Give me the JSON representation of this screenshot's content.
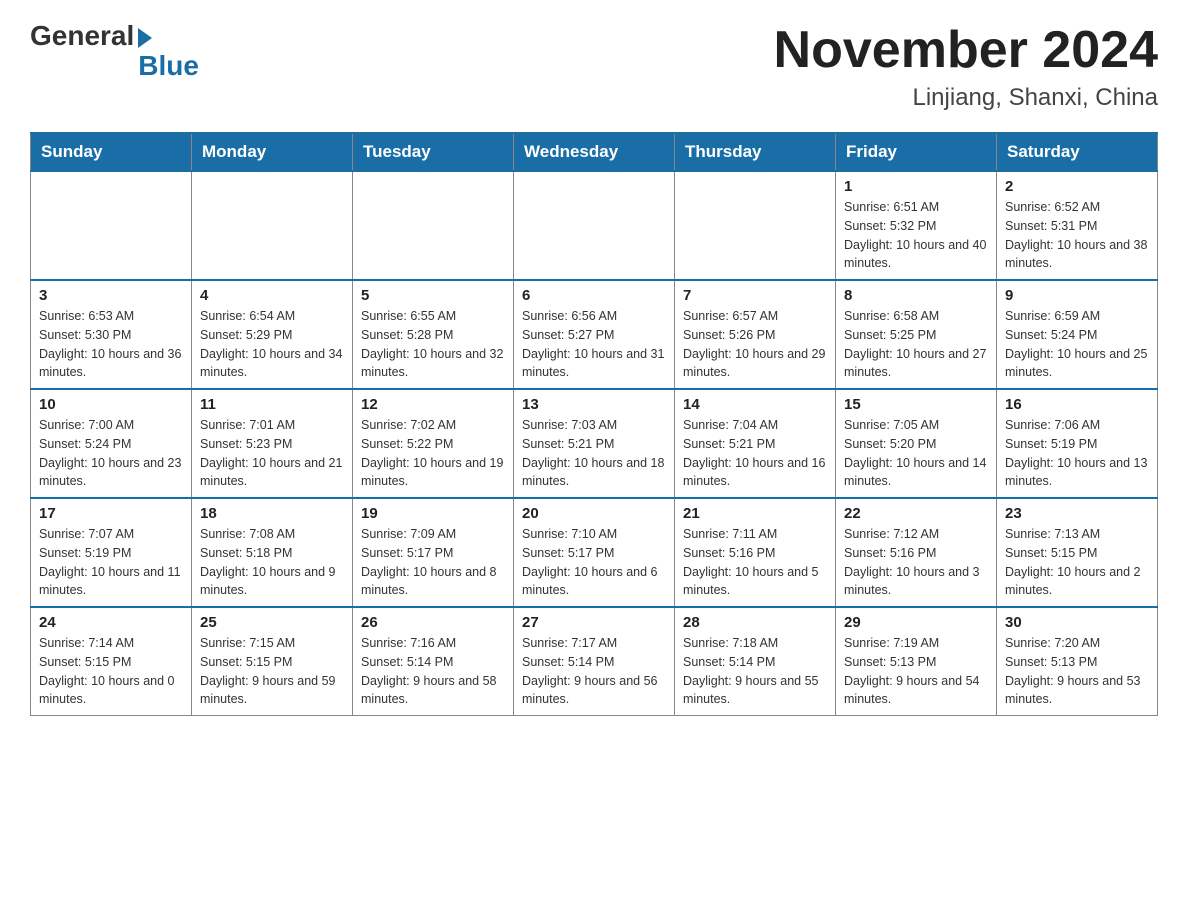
{
  "logo": {
    "general": "General",
    "blue": "Blue"
  },
  "title": {
    "month": "November 2024",
    "location": "Linjiang, Shanxi, China"
  },
  "days_of_week": [
    "Sunday",
    "Monday",
    "Tuesday",
    "Wednesday",
    "Thursday",
    "Friday",
    "Saturday"
  ],
  "weeks": [
    [
      {
        "day": "",
        "info": ""
      },
      {
        "day": "",
        "info": ""
      },
      {
        "day": "",
        "info": ""
      },
      {
        "day": "",
        "info": ""
      },
      {
        "day": "",
        "info": ""
      },
      {
        "day": "1",
        "info": "Sunrise: 6:51 AM\nSunset: 5:32 PM\nDaylight: 10 hours and 40 minutes."
      },
      {
        "day": "2",
        "info": "Sunrise: 6:52 AM\nSunset: 5:31 PM\nDaylight: 10 hours and 38 minutes."
      }
    ],
    [
      {
        "day": "3",
        "info": "Sunrise: 6:53 AM\nSunset: 5:30 PM\nDaylight: 10 hours and 36 minutes."
      },
      {
        "day": "4",
        "info": "Sunrise: 6:54 AM\nSunset: 5:29 PM\nDaylight: 10 hours and 34 minutes."
      },
      {
        "day": "5",
        "info": "Sunrise: 6:55 AM\nSunset: 5:28 PM\nDaylight: 10 hours and 32 minutes."
      },
      {
        "day": "6",
        "info": "Sunrise: 6:56 AM\nSunset: 5:27 PM\nDaylight: 10 hours and 31 minutes."
      },
      {
        "day": "7",
        "info": "Sunrise: 6:57 AM\nSunset: 5:26 PM\nDaylight: 10 hours and 29 minutes."
      },
      {
        "day": "8",
        "info": "Sunrise: 6:58 AM\nSunset: 5:25 PM\nDaylight: 10 hours and 27 minutes."
      },
      {
        "day": "9",
        "info": "Sunrise: 6:59 AM\nSunset: 5:24 PM\nDaylight: 10 hours and 25 minutes."
      }
    ],
    [
      {
        "day": "10",
        "info": "Sunrise: 7:00 AM\nSunset: 5:24 PM\nDaylight: 10 hours and 23 minutes."
      },
      {
        "day": "11",
        "info": "Sunrise: 7:01 AM\nSunset: 5:23 PM\nDaylight: 10 hours and 21 minutes."
      },
      {
        "day": "12",
        "info": "Sunrise: 7:02 AM\nSunset: 5:22 PM\nDaylight: 10 hours and 19 minutes."
      },
      {
        "day": "13",
        "info": "Sunrise: 7:03 AM\nSunset: 5:21 PM\nDaylight: 10 hours and 18 minutes."
      },
      {
        "day": "14",
        "info": "Sunrise: 7:04 AM\nSunset: 5:21 PM\nDaylight: 10 hours and 16 minutes."
      },
      {
        "day": "15",
        "info": "Sunrise: 7:05 AM\nSunset: 5:20 PM\nDaylight: 10 hours and 14 minutes."
      },
      {
        "day": "16",
        "info": "Sunrise: 7:06 AM\nSunset: 5:19 PM\nDaylight: 10 hours and 13 minutes."
      }
    ],
    [
      {
        "day": "17",
        "info": "Sunrise: 7:07 AM\nSunset: 5:19 PM\nDaylight: 10 hours and 11 minutes."
      },
      {
        "day": "18",
        "info": "Sunrise: 7:08 AM\nSunset: 5:18 PM\nDaylight: 10 hours and 9 minutes."
      },
      {
        "day": "19",
        "info": "Sunrise: 7:09 AM\nSunset: 5:17 PM\nDaylight: 10 hours and 8 minutes."
      },
      {
        "day": "20",
        "info": "Sunrise: 7:10 AM\nSunset: 5:17 PM\nDaylight: 10 hours and 6 minutes."
      },
      {
        "day": "21",
        "info": "Sunrise: 7:11 AM\nSunset: 5:16 PM\nDaylight: 10 hours and 5 minutes."
      },
      {
        "day": "22",
        "info": "Sunrise: 7:12 AM\nSunset: 5:16 PM\nDaylight: 10 hours and 3 minutes."
      },
      {
        "day": "23",
        "info": "Sunrise: 7:13 AM\nSunset: 5:15 PM\nDaylight: 10 hours and 2 minutes."
      }
    ],
    [
      {
        "day": "24",
        "info": "Sunrise: 7:14 AM\nSunset: 5:15 PM\nDaylight: 10 hours and 0 minutes."
      },
      {
        "day": "25",
        "info": "Sunrise: 7:15 AM\nSunset: 5:15 PM\nDaylight: 9 hours and 59 minutes."
      },
      {
        "day": "26",
        "info": "Sunrise: 7:16 AM\nSunset: 5:14 PM\nDaylight: 9 hours and 58 minutes."
      },
      {
        "day": "27",
        "info": "Sunrise: 7:17 AM\nSunset: 5:14 PM\nDaylight: 9 hours and 56 minutes."
      },
      {
        "day": "28",
        "info": "Sunrise: 7:18 AM\nSunset: 5:14 PM\nDaylight: 9 hours and 55 minutes."
      },
      {
        "day": "29",
        "info": "Sunrise: 7:19 AM\nSunset: 5:13 PM\nDaylight: 9 hours and 54 minutes."
      },
      {
        "day": "30",
        "info": "Sunrise: 7:20 AM\nSunset: 5:13 PM\nDaylight: 9 hours and 53 minutes."
      }
    ]
  ]
}
